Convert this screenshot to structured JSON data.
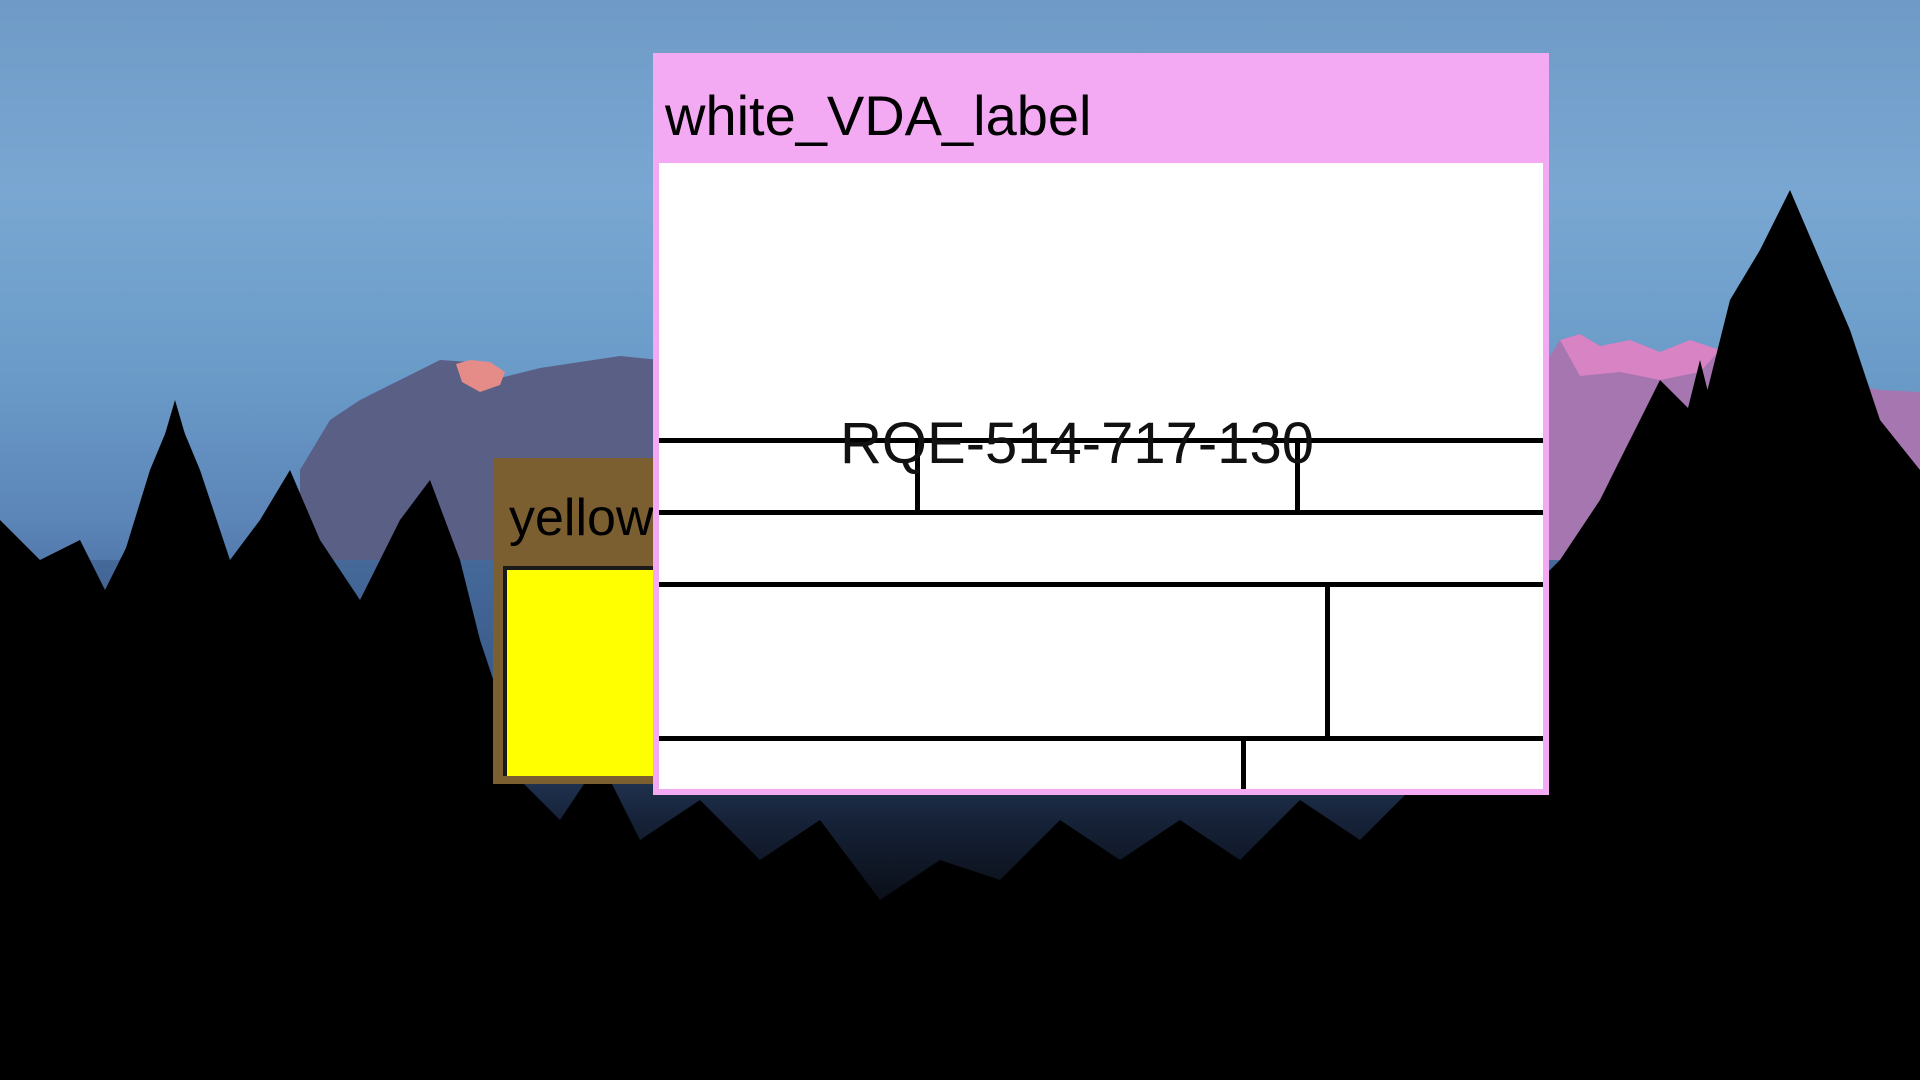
{
  "desktop": {
    "wallpaper": "mountain-forest-dusk"
  },
  "windows": {
    "yellow": {
      "title": "yellow",
      "title_bar_color": "#7c5f30",
      "body_color": "#ffff00"
    },
    "white": {
      "title": "white_VDA_label",
      "title_bar_color": "#f4aaf3",
      "body_color": "#ffffff",
      "label_code": "RQE-514-717-130"
    }
  }
}
